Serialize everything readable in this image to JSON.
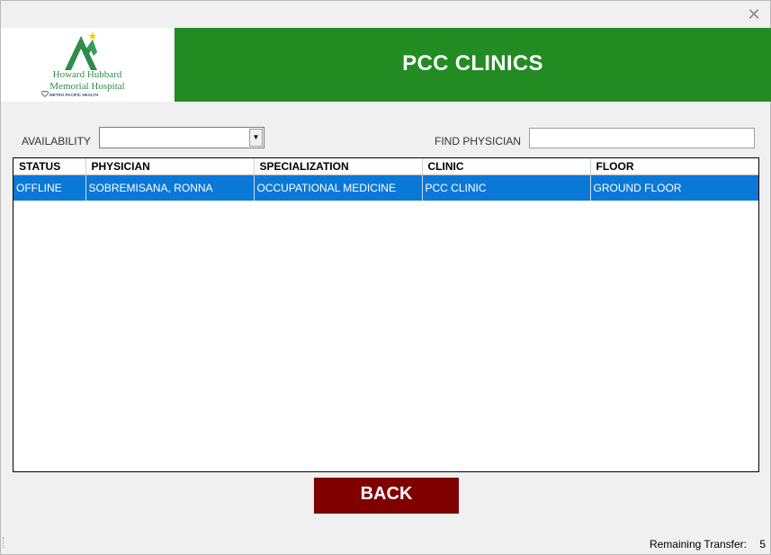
{
  "window": {
    "close_icon": "close-icon"
  },
  "logo": {
    "line1": "Howard Hubbard",
    "line2": "Memorial Hospital",
    "sub": "METRO PACIFIC HEALTH",
    "icon": "mountain-logo-icon",
    "colors": {
      "mountain": "#2e8b4c",
      "star": "#e8d21a"
    }
  },
  "banner": {
    "title": "PCC CLINICS",
    "color": "#228b22"
  },
  "filters": {
    "availability_label": "AVAILABILITY",
    "availability_value": "",
    "find_physician_label": "FIND PHYSICIAN",
    "find_physician_value": ""
  },
  "table": {
    "columns": [
      "STATUS",
      "PHYSICIAN",
      "SPECIALIZATION",
      "CLINIC",
      "FLOOR"
    ],
    "rows": [
      [
        "OFFLINE",
        "SOBREMISANA, RONNA",
        "OCCUPATIONAL MEDICINE",
        "PCC CLINIC",
        "GROUND FLOOR"
      ]
    ],
    "selected_color": "#0a78d7"
  },
  "back_button": {
    "label": "BACK",
    "color": "#800000"
  },
  "status": {
    "remaining_label": "Remaining Transfer:",
    "remaining_value": "5"
  }
}
